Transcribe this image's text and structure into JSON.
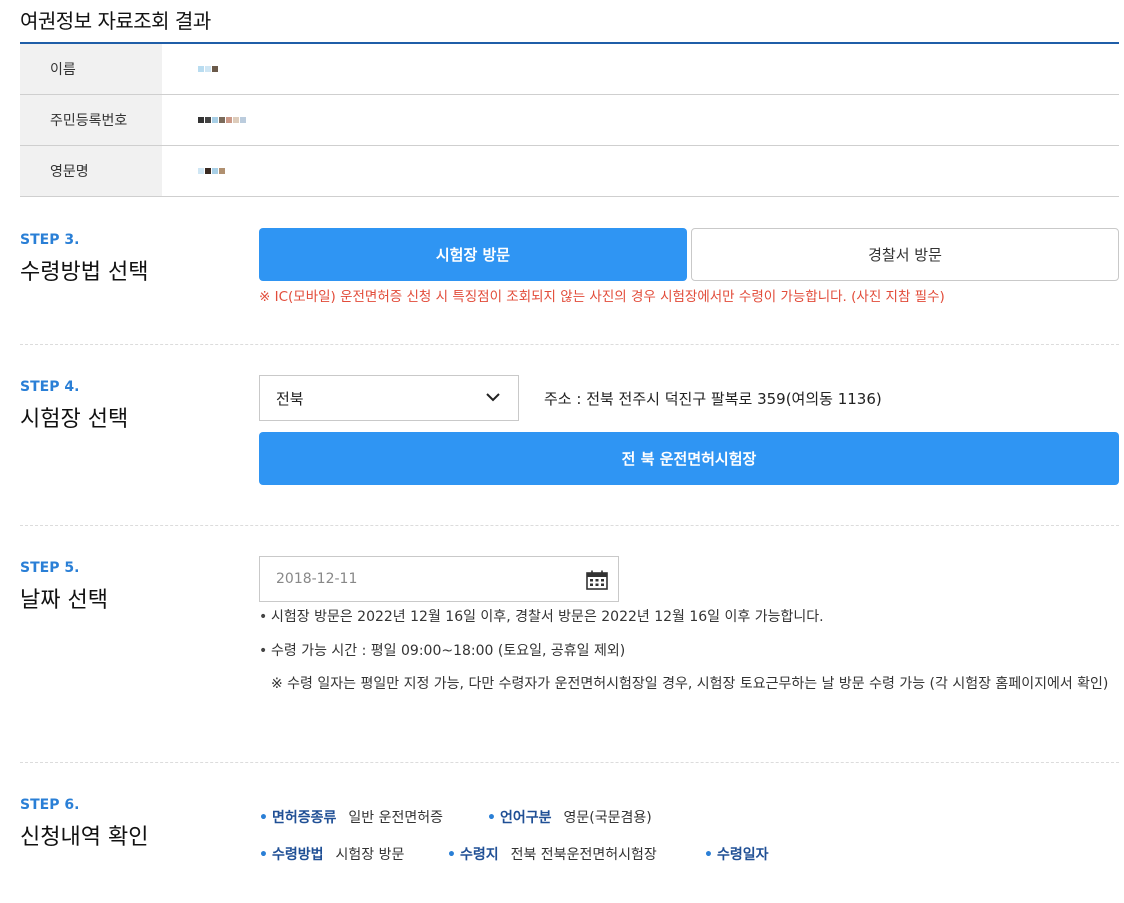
{
  "page": {
    "title": "여권정보 자료조회 결과"
  },
  "info": {
    "rows": [
      {
        "label": "이름"
      },
      {
        "label": "주민등록번호"
      },
      {
        "label": "영문명"
      }
    ]
  },
  "step3": {
    "no": "STEP 3.",
    "title": "수령방법 선택",
    "option_selected": "시험장 방문",
    "option_other": "경찰서 방문",
    "notice": "※ IC(모바일) 운전면허증 신청 시 특징점이 조회되지 않는 사진의 경우 시험장에서만 수령이 가능합니다. (사진 지참 필수)"
  },
  "step4": {
    "no": "STEP 4.",
    "title": "시험장 선택",
    "region_value": "전북",
    "address": "주소 : 전북 전주시 덕진구 팔복로 359(여의동 1136)",
    "center_button": "전 북 운전면허시험장"
  },
  "step5": {
    "no": "STEP 5.",
    "title": "날짜 선택",
    "date_value": "2018-12-11",
    "bullet1": "시험장 방문은 2022년 12월 16일 이후, 경찰서 방문은 2022년 12월 16일 이후 가능합니다.",
    "bullet2": "수령 가능 시간 : 평일 09:00~18:00 (토요일, 공휴일 제외)",
    "note": "※ 수령 일자는 평일만 지정 가능, 다만 수령자가 운전면허시험장일 경우, 시험장 토요근무하는 날 방문 수령 가능 (각 시험장 홈페이지에서 확인)"
  },
  "step6": {
    "no": "STEP 6.",
    "title": "신청내역 확인",
    "items": [
      {
        "key": "면허증종류",
        "value": "일반 운전면허증"
      },
      {
        "key": "언어구분",
        "value": "영문(국문겸용)"
      },
      {
        "key": "수령방법",
        "value": "시험장 방문"
      },
      {
        "key": "수령지",
        "value": "전북 전북운전면허시험장"
      },
      {
        "key": "수령일자",
        "value": ""
      }
    ]
  },
  "colors": {
    "accent": "#2f95f3",
    "navy": "#1f5ea8",
    "notice": "#e24c3a"
  },
  "icons": {
    "select": "chevron-down-icon",
    "date": "calendar-icon"
  }
}
